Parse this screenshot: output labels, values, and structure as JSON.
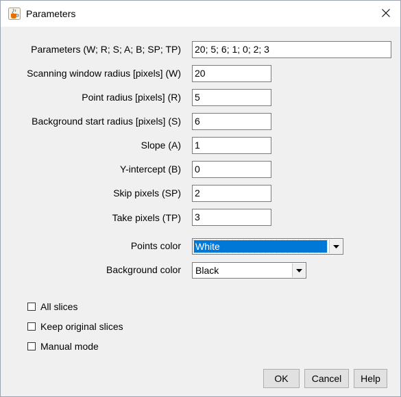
{
  "window": {
    "title": "Parameters",
    "app_icon": "java-coffee-cup-icon",
    "close_icon": "close-icon"
  },
  "fields": [
    {
      "label": "Parameters (W; R; S; A; B; SP; TP)",
      "value": "20; 5; 6; 1; 0; 2; 3"
    },
    {
      "label": "Scanning window radius [pixels] (W)",
      "value": "20"
    },
    {
      "label": "Point radius [pixels] (R)",
      "value": "5"
    },
    {
      "label": "Background start radius [pixels] (S)",
      "value": "6"
    },
    {
      "label": "Slope (A)",
      "value": "1"
    },
    {
      "label": "Y-intercept (B)",
      "value": "0"
    },
    {
      "label": "Skip pixels (SP)",
      "value": "2"
    },
    {
      "label": "Take pixels (TP)",
      "value": "3"
    }
  ],
  "dropdowns": [
    {
      "label": "Points color",
      "value": "White",
      "focused": true
    },
    {
      "label": "Background color",
      "value": "Black",
      "focused": false
    }
  ],
  "checkboxes": [
    {
      "label": "All slices",
      "checked": false
    },
    {
      "label": "Keep original slices",
      "checked": false
    },
    {
      "label": "Manual mode",
      "checked": false
    }
  ],
  "buttons": {
    "ok": "OK",
    "cancel": "Cancel",
    "help": "Help"
  },
  "colors": {
    "selection": "#0078d7",
    "dialog_bg": "#f0f0f0",
    "titlebar_bg": "#ffffff"
  }
}
